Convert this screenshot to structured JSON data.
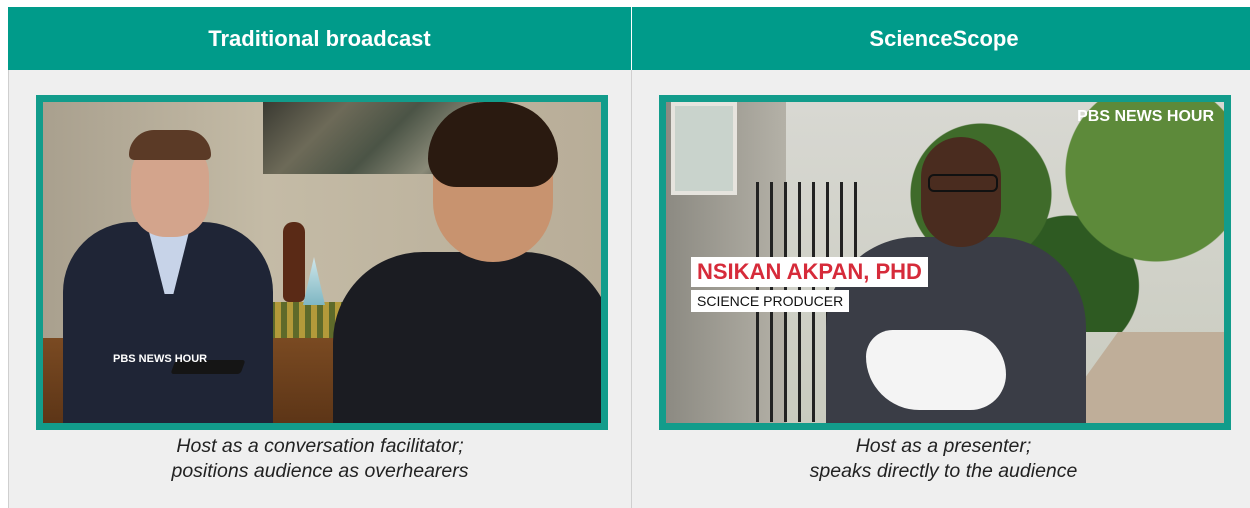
{
  "columns": [
    {
      "header": "Traditional broadcast",
      "caption_line1": "Host as a conversation facilitator;",
      "caption_line2": "positions audience as overhearers",
      "image_logo": "PBS NEWS HOUR"
    },
    {
      "header": "ScienceScope",
      "caption_line1": "Host as a presenter;",
      "caption_line2": "speaks directly to the audience",
      "image_logo": "PBS NEWS HOUR",
      "lower_third_name": "NSIKAN AKPAN, PHD",
      "lower_third_title": "SCIENCE PRODUCER"
    }
  ],
  "colors": {
    "header_bg": "#009b8a",
    "frame_border": "#129c8b",
    "cell_bg": "#efefef",
    "name_red": "#d62b3a"
  }
}
